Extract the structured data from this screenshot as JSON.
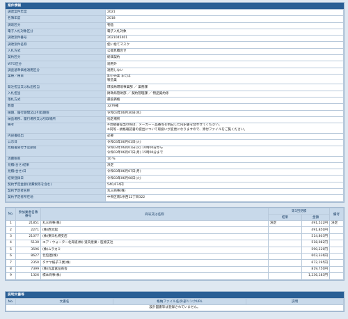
{
  "info_title": "案件情報",
  "info_rows": [
    {
      "label": "調達案件年度",
      "value": "2021"
    },
    {
      "label": "名簿年度",
      "value": "2018"
    },
    {
      "label": "調達区分",
      "value": "物品"
    },
    {
      "label": "電子入札対象区分",
      "value": "電子入札対象"
    },
    {
      "label": "調達案件番号",
      "value": "2021045401"
    },
    {
      "label": "調達案件名称",
      "value": "使い捨てマスク"
    },
    {
      "label": "入札方式",
      "value": "公開見積合せ"
    },
    {
      "label": "契約区分",
      "value": "総価契約"
    },
    {
      "label": "WTO区分",
      "value": "適用外"
    },
    {
      "label": "調査基準価格適用区分",
      "value": "適用しない"
    },
    {
      "label": "業種／種目",
      "value": "卸小売業 または\n製造業",
      "tall": true
    },
    {
      "label": "発注担当又は払出担当",
      "value": "環境局環境事業部 ／ 業務課"
    },
    {
      "label": "入札担当",
      "value": "財政局管財部 ／ 契約管理課 ／ 物品契約係"
    },
    {
      "label": "落札方式",
      "value": "最低価格"
    },
    {
      "label": "数量",
      "value": "3279箱"
    },
    {
      "label": "納期、履行期間又は引取期限",
      "value": "令和03年06月30日(水)"
    },
    {
      "label": "納品場所、履行場所又は引取場所",
      "value": "指定場所"
    },
    {
      "label": "備考",
      "value": "※見積書提出の際は、メーカー・品番等を明記した内訳書を合わせてください。\n※同等・規格確認書の提出について取扱いが変更になりますので、添付ファイルをご覧ください。",
      "tall": true
    },
    {
      "label": "内訳書提出",
      "value": "必要"
    },
    {
      "label": "公示日",
      "value": "令和03年06月01日(火)"
    },
    {
      "label": "見積書受付予定期間",
      "value": "令和03年06月01日(火) 10時00分から\n令和03年06月07日(月) 15時00分まで",
      "tall": true
    },
    {
      "label": "消費税率",
      "value": "10 %"
    },
    {
      "label": "見積(合せ)結果",
      "value": "決定"
    },
    {
      "label": "見積(合せ)日",
      "value": "令和03年06月07日(月)"
    },
    {
      "label": "結果登録日",
      "value": "令和03年06月08日(火)"
    },
    {
      "label": "契約予定金額(消費税等を含む)",
      "value": "540,674円"
    },
    {
      "label": "契約予定者名称",
      "value": "丸三商事(株)"
    },
    {
      "label": "契約予定者所在地",
      "value": "中央区南1条西12丁目322"
    }
  ],
  "results": {
    "headers": {
      "no": "No.",
      "member_no": "参加業者名簿\n番号",
      "name": "商号又は名称",
      "round1": "第1回見積",
      "result": "結果",
      "amount": "金額",
      "remark": "備考"
    },
    "rows": [
      {
        "no": "1",
        "member_no": "21851",
        "name": "丸三商事(株)",
        "result": "決定",
        "amount": "491,522円",
        "remark": "決定"
      },
      {
        "no": "2",
        "member_no": "2271",
        "name": "(株)西文舘",
        "result": "",
        "amount": "491,850円",
        "remark": ""
      },
      {
        "no": "3",
        "member_no": "21077",
        "name": "(株)東日札幌支店",
        "result": "",
        "amount": "514,803円",
        "remark": ""
      },
      {
        "no": "4",
        "member_no": "5130",
        "name": "エア・ウォーター北海道(株) 道央産業・医療支社",
        "result": "",
        "amount": "518,082円",
        "remark": ""
      },
      {
        "no": "5",
        "member_no": "3596",
        "name": "(株)ムラカミ",
        "result": "",
        "amount": "590,220円",
        "remark": ""
      },
      {
        "no": "6",
        "member_no": "8627",
        "name": "北包連(株)",
        "result": "",
        "amount": "603,336円",
        "remark": ""
      },
      {
        "no": "7",
        "member_no": "2350",
        "name": "タケヤ紙子工業(株)",
        "result": "",
        "amount": "672,195円",
        "remark": ""
      },
      {
        "no": "8",
        "member_no": "7399",
        "name": "(株)丸喜富岳商会",
        "result": "",
        "amount": "819,750円",
        "remark": ""
      },
      {
        "no": "9",
        "member_no": "1326",
        "name": "標本商事(株)",
        "result": "",
        "amount": "1,236,183円",
        "remark": ""
      }
    ]
  },
  "docs_title": "説明文書等",
  "docs": {
    "headers": {
      "no": "No.",
      "doc": "文書名",
      "file": "格納ファイル名/外部リンクURL",
      "desc": "説明"
    },
    "empty_message": "設計図書等は登録されていません。"
  }
}
